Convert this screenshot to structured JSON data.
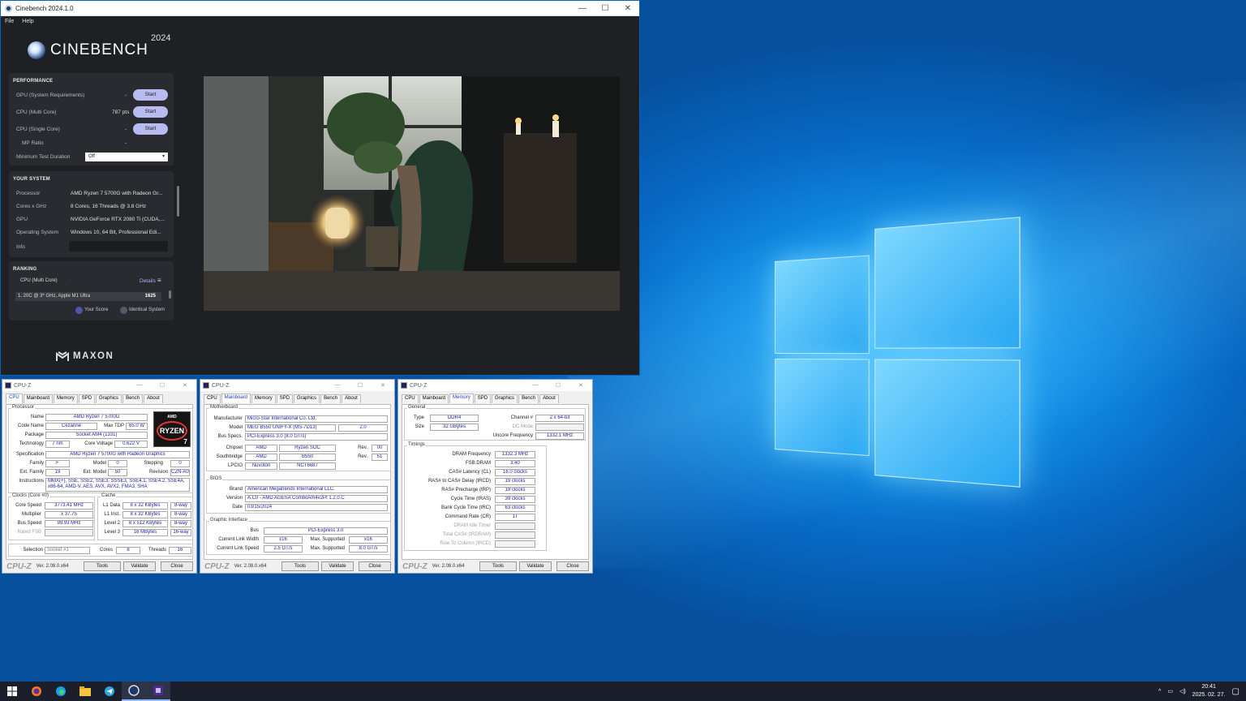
{
  "cinebench": {
    "window_title": "Cinebench 2024.1.0",
    "menu": [
      "File",
      "Help"
    ],
    "logo_text": "CINEBENCH",
    "logo_year": "2024",
    "performance": {
      "heading": "PERFORMANCE",
      "rows": [
        {
          "label": "GPU (System Requirements)",
          "value": "-",
          "button": "Start"
        },
        {
          "label": "CPU (Multi Core)",
          "value": "787 pts",
          "button": "Start"
        },
        {
          "label": "CPU (Single Core)",
          "value": "-",
          "button": "Start"
        }
      ],
      "mp_ratio_label": "MP Ratio",
      "mp_ratio_value": "-",
      "min_duration_label": "Minimum Test Duration",
      "min_duration_value": "Off"
    },
    "your_system": {
      "heading": "YOUR SYSTEM",
      "rows": [
        {
          "label": "Processor",
          "value": "AMD Ryzen 7 5700G with Radeon Gr..."
        },
        {
          "label": "Cores x GHz",
          "value": "8 Cores, 16 Threads @ 3.8 GHz"
        },
        {
          "label": "GPU",
          "value": "NVIDIA GeForce RTX 2080 Ti (CUDA,..."
        },
        {
          "label": "Operating System",
          "value": "Windows 10, 64 Bit, Professional Edi..."
        },
        {
          "label": "Info",
          "value": ""
        }
      ]
    },
    "ranking": {
      "heading": "RANKING",
      "dropdown": "CPU (Multi Core)",
      "details": "Details",
      "entry_name": "1. 20C @ 3* GHz, Apple M1 Ultra",
      "entry_score": "1625",
      "legend_your": "Your Score",
      "legend_identical": "Identical System"
    },
    "brand": "MAXON"
  },
  "cpuz_cpu": {
    "title": "CPU-Z",
    "tabs": [
      "CPU",
      "Mainboard",
      "Memory",
      "SPD",
      "Graphics",
      "Bench",
      "About"
    ],
    "active": "CPU",
    "processor_group": "Processor",
    "name_label": "Name",
    "name": "AMD Ryzen 7 5700G",
    "codename_label": "Code Name",
    "codename": "Cezanne",
    "maxtdp_label": "Max TDP",
    "maxtdp": "65.0 W",
    "package_label": "Package",
    "package": "Socket AM4 (1331)",
    "tech_label": "Technology",
    "tech": "7 nm",
    "corev_label": "Core Voltage",
    "corev": "0.622 V",
    "spec_label": "Specification",
    "spec": "AMD Ryzen 7 5700G with Radeon Graphics",
    "family_label": "Family",
    "family": "F",
    "model_label": "Model",
    "model": "0",
    "stepping_label": "Stepping",
    "stepping": "0",
    "extfam_label": "Ext. Family",
    "extfam": "19",
    "extmodel_label": "Ext. Model",
    "extmodel": "50",
    "rev_label": "Revision",
    "rev": "CZN-A0",
    "instr_label": "Instructions",
    "instr": "MMX(+), SSE, SSE2, SSE3, SSSE3, SSE4.1, SSE4.2, SSE4A, x86-64, AMD-V, AES, AVX, AVX2, FMA3, SHA",
    "clocks_group": "Clocks (Core #0)",
    "cache_group": "Cache",
    "corespeed_label": "Core Speed",
    "corespeed": "3773.41 MHz",
    "mult_label": "Multiplier",
    "mult": "x 37.75",
    "bus_label": "Bus Speed",
    "bus": "99.93 MHz",
    "fsb_label": "Rated FSB",
    "fsb": "",
    "l1d_label": "L1 Data",
    "l1d": "8 x 32 KBytes",
    "l1d_way": "8-way",
    "l1i_label": "L1 Inst.",
    "l1i": "8 x 32 KBytes",
    "l1i_way": "8-way",
    "l2_label": "Level 2",
    "l2": "8 x 512 KBytes",
    "l2_way": "8-way",
    "l3_label": "Level 3",
    "l3": "16 MBytes",
    "l3_way": "16-way",
    "selection_label": "Selection",
    "selection": "Socket #1",
    "cores_label": "Cores",
    "cores": "8",
    "threads_label": "Threads",
    "threads": "16",
    "logo_brand": "AMD",
    "logo_text": "RYZEN",
    "logo_num": "7",
    "brand": "CPU-Z",
    "version": "Ver. 2.08.0.x64",
    "tools": "Tools",
    "validate": "Validate",
    "close": "Close"
  },
  "cpuz_mb": {
    "title": "CPU-Z",
    "tabs": [
      "CPU",
      "Mainboard",
      "Memory",
      "SPD",
      "Graphics",
      "Bench",
      "About"
    ],
    "active": "Mainboard",
    "mb_group": "Motherboard",
    "manuf_label": "Manufacturer",
    "manuf": "Micro-Star International Co. Ltd.",
    "model_label": "Model",
    "model": "MEG B550 UNIFY-X (MS-7D13)",
    "model_rev": "2.0",
    "busspecs_label": "Bus Specs.",
    "busspecs": "PCI-Express 3.0 (8.0 GT/s)",
    "chipset_label": "Chipset",
    "chipset_v": "AMD",
    "chipset_n": "Ryzen SOC",
    "chipset_rev_label": "Rev.",
    "chipset_rev": "00",
    "south_label": "Southbridge",
    "south_v": "AMD",
    "south_n": "B550",
    "south_rev_label": "Rev.",
    "south_rev": "51",
    "lpcio_label": "LPCIO",
    "lpcio_v": "Nuvoton",
    "lpcio_n": "NCT6687",
    "bios_group": "BIOS",
    "brand_label": "Brand",
    "brand_v": "American Megatrends International LLC.",
    "version_label": "Version",
    "version_v": "A.C0 - AMD AGESA ComboAm4v2PI 1.2.0.C",
    "date_label": "Date",
    "date_v": "03/15/2024",
    "gi_group": "Graphic Interface",
    "gbus_label": "Bus",
    "gbus": "PCI-Express 3.0",
    "clw_label": "Current Link Width",
    "clw": "x16",
    "msw_label": "Max. Supported",
    "msw": "x16",
    "cls_label": "Current Link Speed",
    "cls": "2.5 GT/s",
    "mss_label": "Max. Supported",
    "mss": "8.0 GT/s",
    "brand": "CPU-Z",
    "ver": "Ver. 2.08.0.x64",
    "tools": "Tools",
    "validate": "Validate",
    "close": "Close"
  },
  "cpuz_mem": {
    "title": "CPU-Z",
    "tabs": [
      "CPU",
      "Mainboard",
      "Memory",
      "SPD",
      "Graphics",
      "Bench",
      "About"
    ],
    "active": "Memory",
    "general_group": "General",
    "type_label": "Type",
    "type": "DDR4",
    "channel_label": "Channel #",
    "channel": "2 x 64-bit",
    "dcmode_label": "DC Mode",
    "dcmode": "",
    "size_label": "Size",
    "size": "32 GBytes",
    "uncore_label": "Uncore Frequency",
    "uncore": "1332.1 MHz",
    "timings_group": "Timings",
    "timings": [
      {
        "label": "DRAM Frequency",
        "value": "1332.3 MHz"
      },
      {
        "label": "FSB:DRAM",
        "value": "3:40"
      },
      {
        "label": "CAS# Latency (CL)",
        "value": "16.0 clocks"
      },
      {
        "label": "RAS# to CAS# Delay (tRCD)",
        "value": "19 clocks"
      },
      {
        "label": "RAS# Precharge (tRP)",
        "value": "19 clocks"
      },
      {
        "label": "Cycle Time (tRAS)",
        "value": "39 clocks"
      },
      {
        "label": "Bank Cycle Time (tRC)",
        "value": "63 clocks"
      },
      {
        "label": "Command Rate (CR)",
        "value": "1T"
      },
      {
        "label": "DRAM Idle Timer",
        "value": ""
      },
      {
        "label": "Total CAS# (tRDRAM)",
        "value": ""
      },
      {
        "label": "Row To Column (tRCD)",
        "value": ""
      }
    ],
    "brand": "CPU-Z",
    "ver": "Ver. 2.08.0.x64",
    "tools": "Tools",
    "validate": "Validate",
    "close": "Close"
  },
  "taskbar": {
    "time": "20:41",
    "date": "2025. 02. 27."
  },
  "colors": {
    "desktop": "#0a7ae0",
    "cinebench_bg": "#1f2024",
    "start_button": "#b7bbf0",
    "taskbar": "#1a1f2b",
    "cpuz_value": "#1b1ba3"
  }
}
